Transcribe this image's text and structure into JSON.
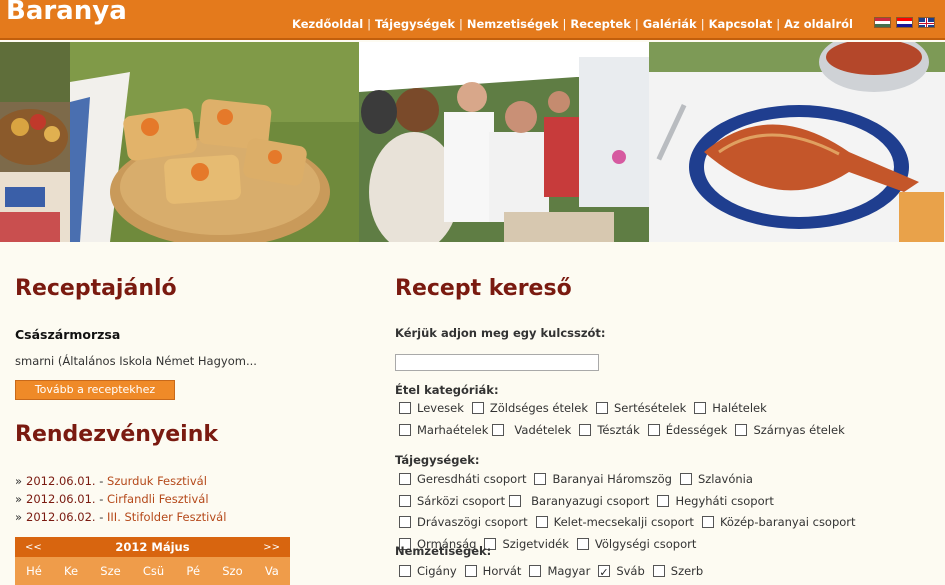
{
  "header": {
    "site_title": "Baranya",
    "nav": [
      "Kezdőoldal",
      "Tájegységek",
      "Nemzetiségek",
      "Receptek",
      "Galériák",
      "Kapcsolat",
      "Az oldalról"
    ],
    "flags": [
      "hungarian-flag-icon",
      "croatian-flag-icon",
      "uk-flag-icon"
    ]
  },
  "banner": {
    "photos": [
      "bread-tapas-photo",
      "festival-chefs-photo",
      "fish-plate-photo"
    ]
  },
  "recipe_tip": {
    "heading": "Receptajánló",
    "name": "Császármorzsa",
    "description": "smarni (Általános Iskola Német Hagyom...",
    "button": "Tovább a receptekhez"
  },
  "events": {
    "heading": "Rendezvényeink",
    "items": [
      {
        "bullet": "»",
        "date": "2012.06.01.",
        "title": "Szurduk Fesztivál"
      },
      {
        "bullet": "»",
        "date": "2012.06.01.",
        "title": "Cirfandli Fesztivál"
      },
      {
        "bullet": "»",
        "date": "2012.06.02.",
        "title": "III. Stifolder Fesztivál"
      }
    ]
  },
  "calendar": {
    "prev": "<<",
    "month": "2012 Május",
    "next": ">>",
    "weekdays": [
      "Hé",
      "Ke",
      "Sze",
      "Csü",
      "Pé",
      "Szo",
      "Va"
    ]
  },
  "search": {
    "heading": "Recept kereső",
    "keyword_label": "Kérjük adjon meg egy kulcsszót:",
    "keyword_value": "",
    "categories_label": "Étel kategóriák:",
    "categories": [
      "Levesek",
      "Zöldséges ételek",
      "Sertésételek",
      "Halételek",
      "Marhaételek",
      "Vadételek",
      "Tészták",
      "Édességek",
      "Szárnyas ételek"
    ],
    "regions_label": "Tájegységek:",
    "regions": [
      "Geresdháti csoport",
      "Baranyai Háromszög",
      "Szlavónia",
      "Sárközi csoport",
      "Baranyazugi csoport",
      "Hegyháti csoport",
      "Drávaszögi csoport",
      "Kelet-mecsekalji csoport",
      "Közép-baranyai csoport",
      "Ormánság",
      "Szigetvidék",
      "Völgységi csoport"
    ],
    "nationalities_label": "Nemzetiségek:",
    "nationalities": [
      {
        "label": "Cigány",
        "checked": false
      },
      {
        "label": "Horvát",
        "checked": false
      },
      {
        "label": "Magyar",
        "checked": false
      },
      {
        "label": "Sváb",
        "checked": true
      },
      {
        "label": "Szerb",
        "checked": false
      }
    ]
  }
}
